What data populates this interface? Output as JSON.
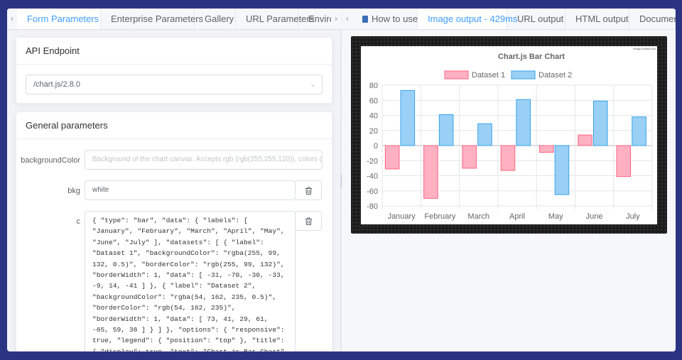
{
  "left_tabs": [
    "Form Parameters",
    "Enterprise Parameters",
    "Gallery",
    "URL Parameters",
    "Enviro"
  ],
  "api_endpoint": {
    "title": "API Endpoint",
    "value": "/chart.js/2.8.0"
  },
  "general": {
    "title": "General parameters",
    "backgroundColor": {
      "label": "backgroundColor",
      "placeholder": "Background of the chart canvas. Accepts rgb (rgb(255,255,120)), colors ("
    },
    "bkg": {
      "label": "bkg",
      "value": "white"
    },
    "c": {
      "label": "c",
      "value": "{ \"type\": \"bar\", \"data\": { \"labels\": [\n\"January\", \"February\", \"March\", \"April\", \"May\",\n\"June\", \"July\" ], \"datasets\": [ { \"label\":\n\"Dataset 1\", \"backgroundColor\": \"rgba(255, 99,\n132, 0.5)\", \"borderColor\": \"rgb(255, 99, 132)\",\n\"borderWidth\": 1, \"data\": [ -31, -70, -30, -33,\n-9, 14, -41 ] }, { \"label\": \"Dataset 2\",\n\"backgroundColor\": \"rgba(54, 162, 235, 0.5)\",\n\"borderColor\": \"rgb(54, 162, 235)\",\n\"borderWidth\": 1, \"data\": [ 73, 41, 29, 61,\n-65, 59, 38 ] } ] }, \"options\": { \"responsive\":\ntrue, \"legend\": { \"position\": \"top\" }, \"title\":\n{ \"display\": true, \"text\": \"Chart.js Bar Chart\"\n} } }"
    }
  },
  "right_tabs": [
    "How to use",
    "Image output - 429ms",
    "URL output",
    "HTML output",
    "Documer"
  ],
  "watermark": "image-charts.com",
  "colors": {
    "accent": "#409eff",
    "series1_fill": "#ffb1c1",
    "series1_border": "#ff6384",
    "series2_fill": "#9ad0f5",
    "series2_border": "#36a2eb"
  },
  "chart_data": {
    "type": "bar",
    "title": "Chart.js Bar Chart",
    "categories": [
      "January",
      "February",
      "March",
      "April",
      "May",
      "June",
      "July"
    ],
    "series": [
      {
        "name": "Dataset 1",
        "values": [
          -31,
          -70,
          -30,
          -33,
          -9,
          14,
          -41
        ]
      },
      {
        "name": "Dataset 2",
        "values": [
          73,
          41,
          29,
          61,
          -65,
          59,
          38
        ]
      }
    ],
    "ylim": [
      -80,
      80
    ],
    "yticks": [
      80,
      60,
      40,
      20,
      0,
      -20,
      -40,
      -60,
      -80
    ],
    "legend": "top",
    "grid": true
  }
}
